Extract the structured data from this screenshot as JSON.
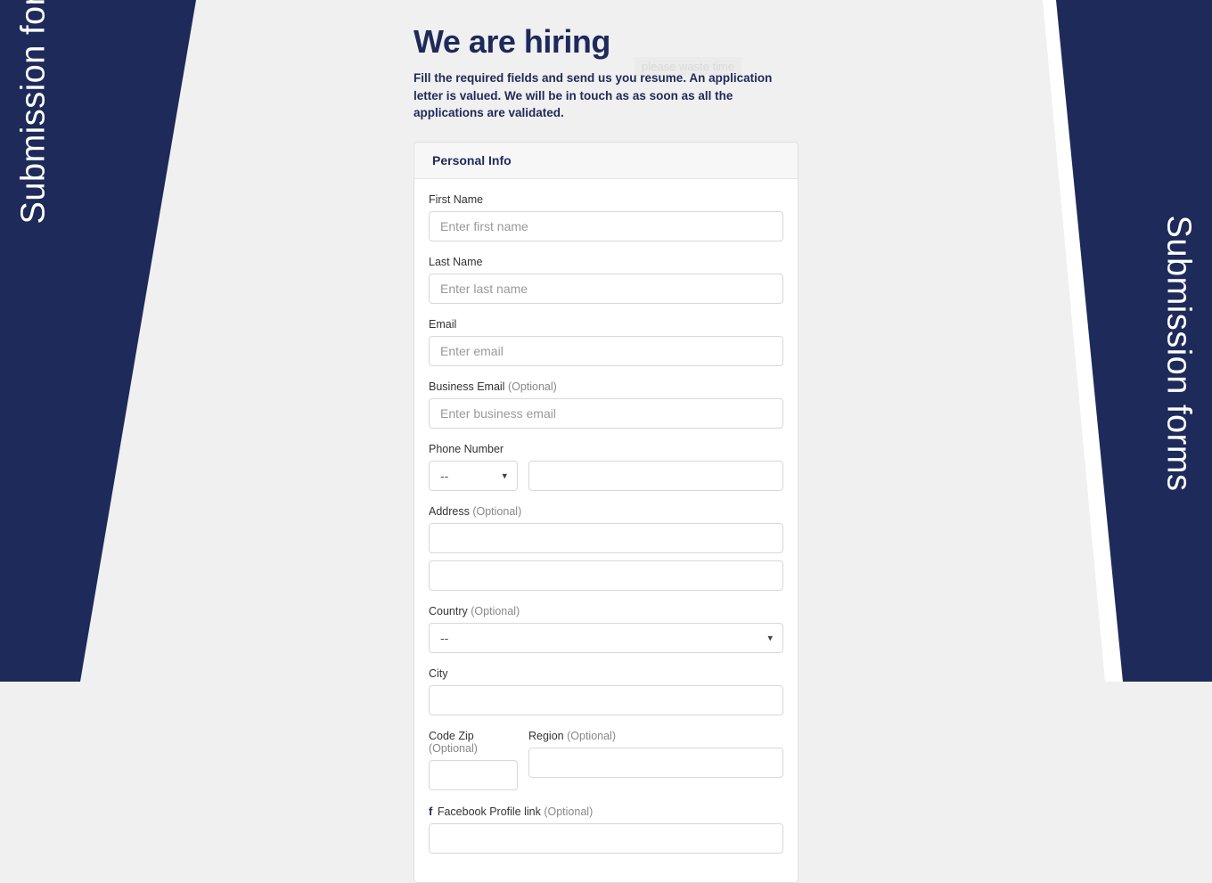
{
  "sideText": "Submission forms",
  "header": {
    "title": "We are hiring",
    "ghost": "please waste time",
    "subtitle": "Fill the required fields and send us you resume. An application letter is valued. We will be in touch as as soon as all the applications are validated."
  },
  "section": {
    "title": "Personal Info"
  },
  "fields": {
    "firstName": {
      "label": "First Name",
      "placeholder": "Enter first name"
    },
    "lastName": {
      "label": "Last Name",
      "placeholder": "Enter last name"
    },
    "email": {
      "label": "Email",
      "placeholder": "Enter email"
    },
    "businessEmail": {
      "label": "Business Email",
      "optional": "(Optional)",
      "placeholder": "Enter business email"
    },
    "phone": {
      "label": "Phone Number",
      "codeSelected": "--"
    },
    "address": {
      "label": "Address",
      "optional": "(Optional)"
    },
    "country": {
      "label": "Country",
      "optional": "(Optional)",
      "selected": "--"
    },
    "city": {
      "label": "City"
    },
    "codeZip": {
      "label": "Code Zip",
      "optional": "(Optional)"
    },
    "region": {
      "label": "Region",
      "optional": "(Optional)"
    },
    "facebook": {
      "label": "Facebook Profile link",
      "optional": "(Optional)"
    }
  }
}
